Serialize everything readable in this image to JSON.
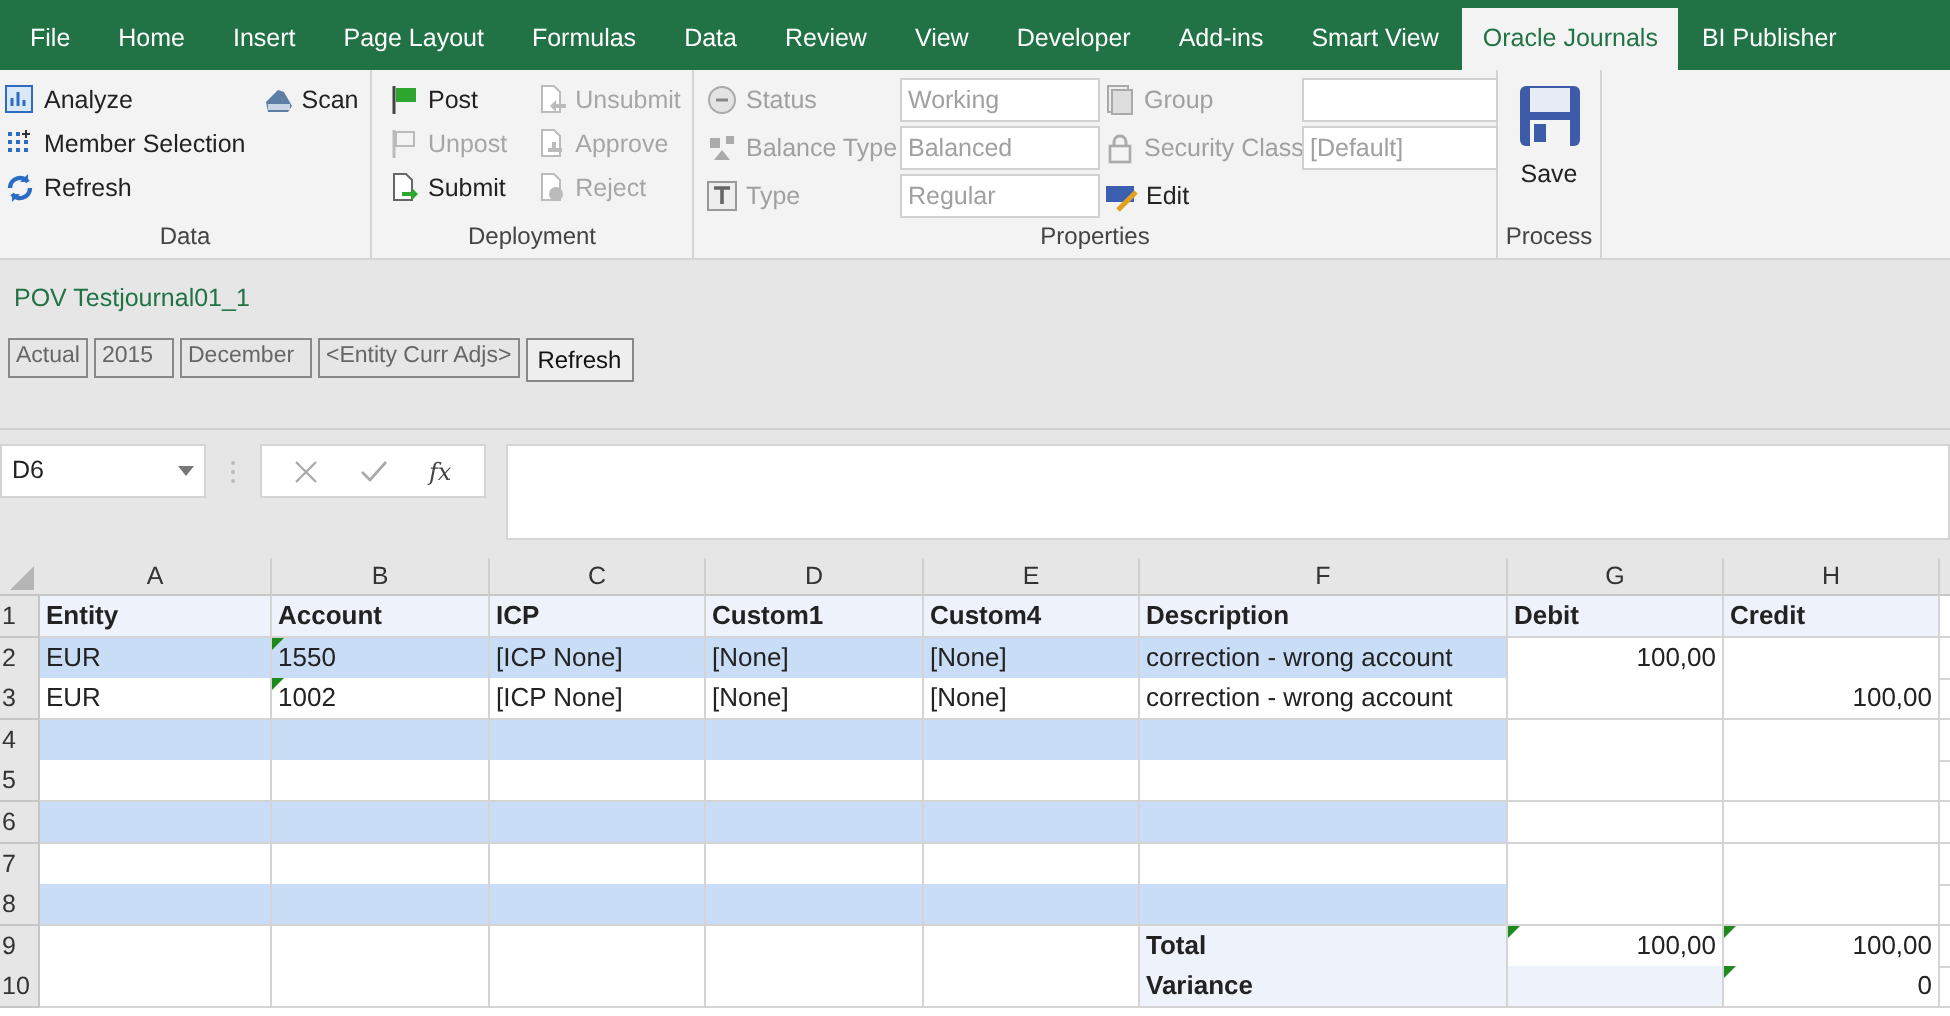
{
  "tabs": [
    {
      "label": "File",
      "selected": false
    },
    {
      "label": "Home",
      "selected": false
    },
    {
      "label": "Insert",
      "selected": false
    },
    {
      "label": "Page Layout",
      "selected": false
    },
    {
      "label": "Formulas",
      "selected": false
    },
    {
      "label": "Data",
      "selected": false
    },
    {
      "label": "Review",
      "selected": false
    },
    {
      "label": "View",
      "selected": false
    },
    {
      "label": "Developer",
      "selected": false
    },
    {
      "label": "Add-ins",
      "selected": false
    },
    {
      "label": "Smart View",
      "selected": false
    },
    {
      "label": "Oracle Journals",
      "selected": true
    },
    {
      "label": "BI Publisher",
      "selected": false
    }
  ],
  "ribbon": {
    "data": {
      "label": "Data",
      "buttons": [
        {
          "label": "Analyze",
          "disabled": false
        },
        {
          "label": "Member Selection",
          "disabled": false
        },
        {
          "label": "Refresh",
          "disabled": false
        },
        {
          "label": "Scan",
          "disabled": false
        }
      ]
    },
    "deployment": {
      "label": "Deployment",
      "buttons": [
        {
          "label": "Post",
          "disabled": false
        },
        {
          "label": "Unpost",
          "disabled": true
        },
        {
          "label": "Submit",
          "disabled": false
        },
        {
          "label": "Unsubmit",
          "disabled": true
        },
        {
          "label": "Approve",
          "disabled": true
        },
        {
          "label": "Reject",
          "disabled": true
        }
      ]
    },
    "properties": {
      "label": "Properties",
      "fields": [
        {
          "label": "Status",
          "value": "Working",
          "disabled": true
        },
        {
          "label": "Balance Type",
          "value": "Balanced",
          "disabled": true
        },
        {
          "label": "Type",
          "value": "Regular",
          "disabled": true
        },
        {
          "label": "Group",
          "disabled": true
        },
        {
          "label": "Security Class",
          "value": "[Default]",
          "disabled": true
        }
      ],
      "edit_button": "Edit"
    },
    "process": {
      "label": "Process",
      "save_button": "Save"
    }
  },
  "pov": {
    "title": "POV Testjournal01_1",
    "members": [
      "Actual",
      "2015",
      "December",
      "<Entity Curr Adjs>"
    ],
    "refresh_button": "Refresh"
  },
  "formula_bar": {
    "name_box": "D6",
    "function_label": "fx"
  },
  "sheet": {
    "columns": [
      "A",
      "B",
      "C",
      "D",
      "E",
      "F",
      "G",
      "H"
    ],
    "rows": [
      {
        "number": "1",
        "cells": [
          {
            "text": "Entity",
            "kind": "header"
          },
          {
            "text": "Account",
            "kind": "header"
          },
          {
            "text": "ICP",
            "kind": "header"
          },
          {
            "text": "Custom1",
            "kind": "header"
          },
          {
            "text": "Custom4",
            "kind": "header"
          },
          {
            "text": "Description",
            "kind": "header"
          },
          {
            "text": "Debit",
            "kind": "header"
          },
          {
            "text": "Credit",
            "kind": "header"
          }
        ]
      },
      {
        "number": "2",
        "cells": [
          {
            "text": "EUR",
            "kind": "band"
          },
          {
            "text": "1550",
            "kind": "band",
            "flagged": true
          },
          {
            "text": "[ICP None]",
            "kind": "band"
          },
          {
            "text": "[None]",
            "kind": "band"
          },
          {
            "text": "[None]",
            "kind": "band"
          },
          {
            "text": "correction - wrong account",
            "kind": "band"
          },
          {
            "text": "100,00",
            "kind": "amount"
          },
          {
            "kind": "plain"
          }
        ]
      },
      {
        "number": "3",
        "cells": [
          {
            "text": "EUR",
            "kind": "plain"
          },
          {
            "text": "1002",
            "kind": "plain",
            "flagged": true
          },
          {
            "text": "[ICP None]",
            "kind": "plain"
          },
          {
            "text": "[None]",
            "kind": "plain"
          },
          {
            "text": "[None]",
            "kind": "plain"
          },
          {
            "text": "correction - wrong account",
            "kind": "plain"
          },
          {
            "kind": "plain"
          },
          {
            "text": "100,00",
            "kind": "amount"
          }
        ]
      },
      {
        "number": "4",
        "cells": [
          {
            "kind": "band"
          },
          {
            "kind": "band"
          },
          {
            "kind": "band"
          },
          {
            "kind": "band"
          },
          {
            "kind": "band"
          },
          {
            "kind": "band"
          },
          {
            "kind": "plain"
          },
          {
            "kind": "plain"
          }
        ]
      },
      {
        "number": "5",
        "cells": [
          {
            "kind": "plain"
          },
          {
            "kind": "plain"
          },
          {
            "kind": "plain"
          },
          {
            "kind": "plain"
          },
          {
            "kind": "plain"
          },
          {
            "kind": "plain"
          },
          {
            "kind": "plain"
          },
          {
            "kind": "plain"
          }
        ]
      },
      {
        "number": "6",
        "cells": [
          {
            "kind": "band"
          },
          {
            "kind": "band"
          },
          {
            "kind": "band"
          },
          {
            "kind": "band"
          },
          {
            "kind": "band"
          },
          {
            "kind": "band"
          },
          {
            "kind": "plain"
          },
          {
            "kind": "plain"
          }
        ]
      },
      {
        "number": "7",
        "cells": [
          {
            "kind": "plain"
          },
          {
            "kind": "plain"
          },
          {
            "kind": "plain"
          },
          {
            "kind": "plain"
          },
          {
            "kind": "plain"
          },
          {
            "kind": "plain"
          },
          {
            "kind": "plain"
          },
          {
            "kind": "plain"
          }
        ]
      },
      {
        "number": "8",
        "cells": [
          {
            "kind": "band"
          },
          {
            "kind": "band"
          },
          {
            "kind": "band"
          },
          {
            "kind": "band"
          },
          {
            "kind": "band"
          },
          {
            "kind": "band"
          },
          {
            "kind": "plain"
          },
          {
            "kind": "plain"
          }
        ]
      },
      {
        "number": "9",
        "cells": [
          {
            "kind": "plain"
          },
          {
            "kind": "plain"
          },
          {
            "kind": "plain"
          },
          {
            "kind": "plain"
          },
          {
            "kind": "plain"
          },
          {
            "text": "Total",
            "kind": "header"
          },
          {
            "text": "100,00",
            "kind": "amount",
            "flagged": true
          },
          {
            "text": "100,00",
            "kind": "amount",
            "flagged": true
          }
        ]
      },
      {
        "number": "10",
        "cells": [
          {
            "kind": "plain"
          },
          {
            "kind": "plain"
          },
          {
            "kind": "plain"
          },
          {
            "kind": "plain"
          },
          {
            "kind": "plain"
          },
          {
            "text": "Variance",
            "kind": "header"
          },
          {
            "kind": "shaded"
          },
          {
            "text": "0",
            "kind": "amount",
            "flagged": true
          }
        ]
      }
    ]
  }
}
